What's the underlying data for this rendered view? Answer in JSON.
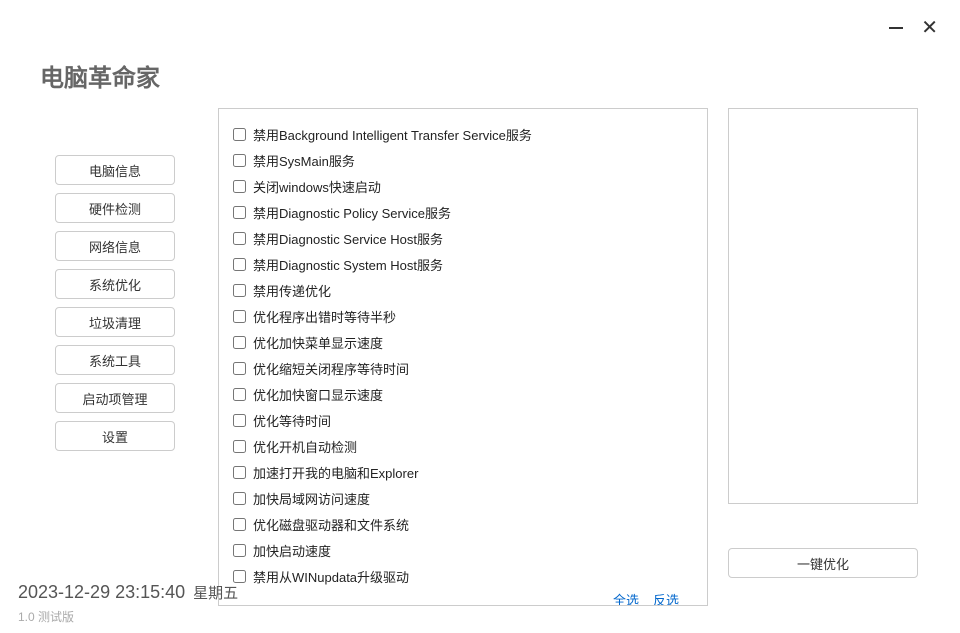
{
  "appTitle": "电脑革命家",
  "sidebar": {
    "items": [
      {
        "label": "电脑信息"
      },
      {
        "label": "硬件检测"
      },
      {
        "label": "网络信息"
      },
      {
        "label": "系统优化"
      },
      {
        "label": "垃圾清理"
      },
      {
        "label": "系统工具"
      },
      {
        "label": "启动项管理"
      },
      {
        "label": "设置"
      }
    ]
  },
  "options": [
    {
      "label": "禁用Background Intelligent Transfer Service服务"
    },
    {
      "label": "禁用SysMain服务"
    },
    {
      "label": "关闭windows快速启动"
    },
    {
      "label": "禁用Diagnostic Policy Service服务"
    },
    {
      "label": "禁用Diagnostic Service Host服务"
    },
    {
      "label": "禁用Diagnostic System Host服务"
    },
    {
      "label": "禁用传递优化"
    },
    {
      "label": "优化程序出错时等待半秒"
    },
    {
      "label": "优化加快菜单显示速度"
    },
    {
      "label": "优化缩短关闭程序等待时间"
    },
    {
      "label": "优化加快窗口显示速度"
    },
    {
      "label": "优化等待时间"
    },
    {
      "label": "优化开机自动检测"
    },
    {
      "label": "加速打开我的电脑和Explorer"
    },
    {
      "label": "加快局域网访问速度"
    },
    {
      "label": "优化磁盘驱动器和文件系统"
    },
    {
      "label": "加快启动速度"
    },
    {
      "label": "禁用从WINupdata升级驱动"
    }
  ],
  "actions": {
    "selectAll": "全选",
    "invert": "反选",
    "optimize": "一键优化"
  },
  "footer": {
    "datetime": "2023-12-29 23:15:40",
    "weekday": "星期五",
    "version": "1.0  测试版"
  }
}
